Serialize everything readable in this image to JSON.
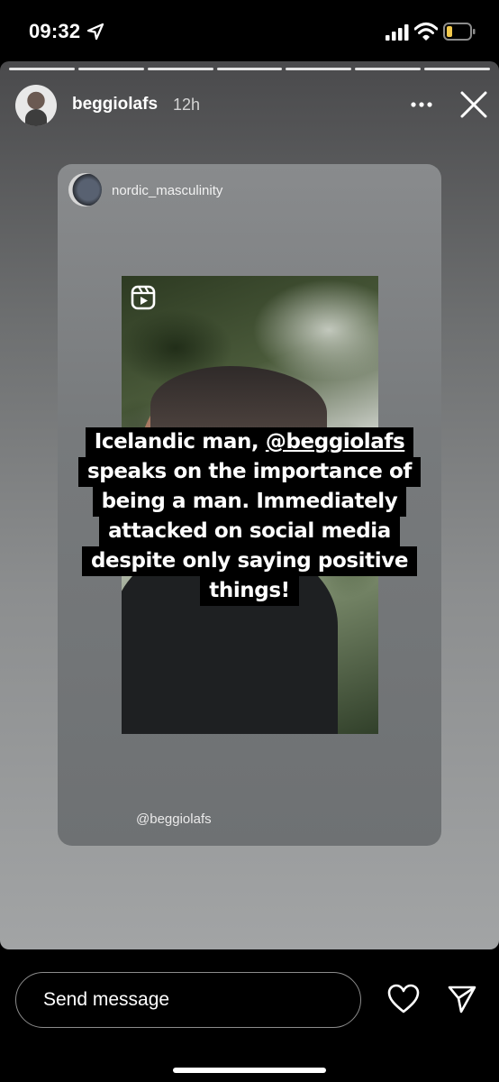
{
  "status_bar": {
    "time": "09:32",
    "icons": [
      "location-arrow-icon",
      "signal-bars-icon",
      "wifi-icon",
      "battery-low-icon"
    ],
    "battery_color": "#f2c94c"
  },
  "story": {
    "segments": 7,
    "username": "beggiolafs",
    "time_ago": "12h",
    "shared_post": {
      "username": "nordic_masculinity",
      "caption_lines": [
        {
          "pre": "Icelandic man, ",
          "mention": "@beggiolafs"
        },
        {
          "text": "speaks on the importance of"
        },
        {
          "text": "being a man. Immediately"
        },
        {
          "text": "attacked on social media"
        },
        {
          "text": "despite only saying positive"
        },
        {
          "text": "things!"
        }
      ],
      "mention_tag": "@beggiolafs"
    }
  },
  "reply_bar": {
    "placeholder": "Send message"
  }
}
